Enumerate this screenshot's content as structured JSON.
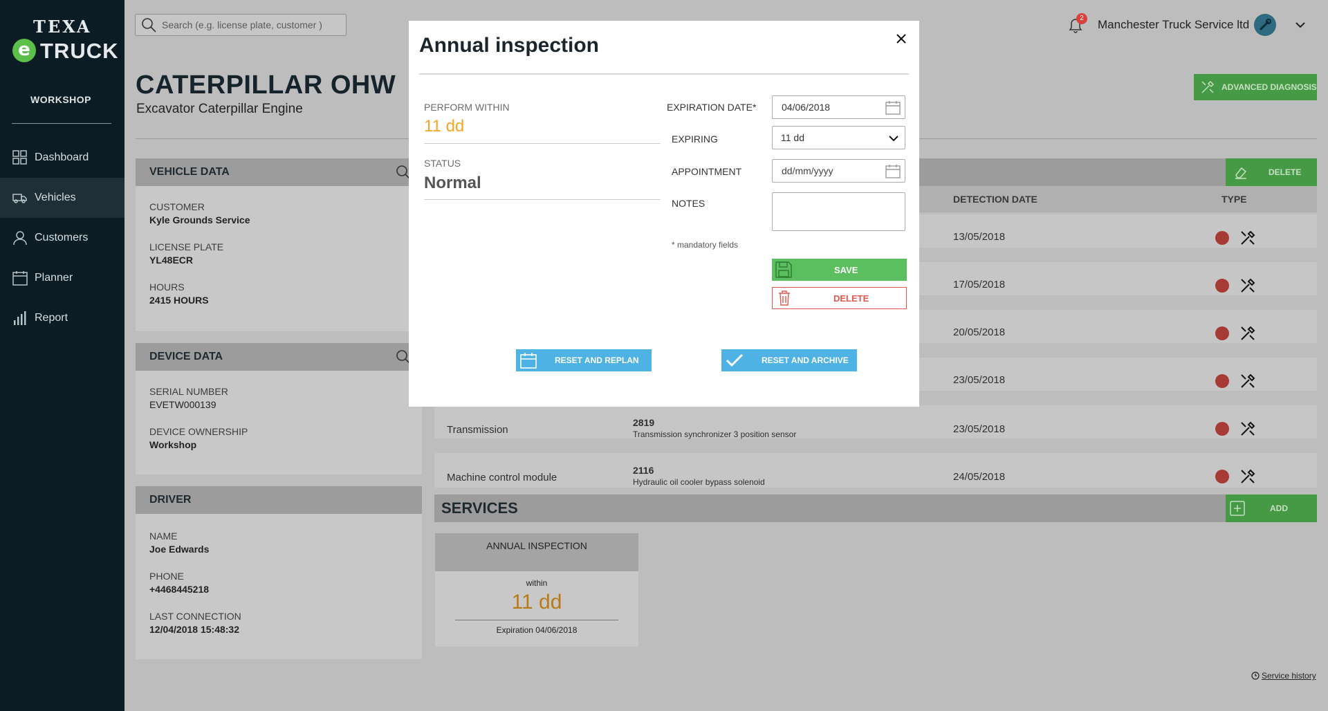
{
  "brand": {
    "line1": "TEXA",
    "e": "e",
    "line2": "TRUCK"
  },
  "sidebar": {
    "section": "WORKSHOP",
    "items": [
      {
        "label": "Dashboard",
        "icon": "grid-icon"
      },
      {
        "label": "Vehicles",
        "icon": "truck-icon",
        "active": true
      },
      {
        "label": "Customers",
        "icon": "user-icon"
      },
      {
        "label": "Planner",
        "icon": "calendar-icon"
      },
      {
        "label": "Report",
        "icon": "bar-chart-icon"
      }
    ]
  },
  "topbar": {
    "search_placeholder": "Search (e.g. license plate, customer )",
    "notifications": "2",
    "company": "Manchester Truck Service ltd"
  },
  "vehicle": {
    "title": "CATERPILLAR OHW",
    "subtitle": "Excavator Caterpillar Engine",
    "advanced_diagnosis": "ADVANCED DIAGNOSIS"
  },
  "panels": {
    "vehicle_data": {
      "title": "VEHICLE DATA",
      "fields": [
        {
          "label": "CUSTOMER",
          "value": "Kyle Grounds Service"
        },
        {
          "label": "LICENSE PLATE",
          "value": "YL48ECR"
        },
        {
          "label": "HOURS",
          "value": "2415 HOURS"
        }
      ]
    },
    "device_data": {
      "title": "DEVICE DATA",
      "fields": [
        {
          "label": "SERIAL NUMBER",
          "value": "EVETW000139"
        },
        {
          "label": "DEVICE OWNERSHIP",
          "value": "Workshop"
        }
      ]
    },
    "driver": {
      "title": "DRIVER",
      "fields": [
        {
          "label": "NAME",
          "value": "Joe Edwards"
        },
        {
          "label": "PHONE",
          "value": "+4468445218"
        },
        {
          "label": "LAST CONNECTION",
          "value": "12/04/2018 15:48:32"
        }
      ]
    }
  },
  "faults": {
    "delete_label": "DELETE",
    "columns": {
      "detection_date": "DETECTION DATE",
      "type": "TYPE"
    },
    "rows": [
      {
        "system": "",
        "code": "",
        "desc": "",
        "date": "13/05/2018"
      },
      {
        "system": "",
        "code": "",
        "desc": "",
        "date": "17/05/2018"
      },
      {
        "system": "",
        "code": "",
        "desc": "",
        "date": "20/05/2018"
      },
      {
        "system": "",
        "code": "",
        "desc": "",
        "date": "23/05/2018"
      },
      {
        "system": "Transmission",
        "code": "2819",
        "desc": "Transmission synchronizer 3 position sensor",
        "date": "23/05/2018"
      },
      {
        "system": "Machine control module",
        "code": "2116",
        "desc": "Hydraulic oil cooler bypass solenoid",
        "date": "24/05/2018"
      }
    ]
  },
  "services": {
    "title": "SERVICES",
    "add_label": "ADD",
    "card": {
      "name": "ANNUAL INSPECTION",
      "within": "within",
      "value": "11 dd",
      "expiration": "Expiration 04/06/2018"
    },
    "history": "Service history"
  },
  "modal": {
    "title": "Annual inspection",
    "perform_within_label": "PERFORM WITHIN",
    "perform_within_value": "11 dd",
    "status_label": "STATUS",
    "status_value": "Normal",
    "expiration_label": "EXPIRATION DATE*",
    "expiration_value": "04/06/2018",
    "expiring_label": "EXPIRING",
    "expiring_value": "11 dd",
    "appointment_label": "APPOINTMENT",
    "appointment_placeholder": "dd/mm/yyyy",
    "notes_label": "NOTES",
    "mandatory": "* mandatory fields",
    "save": "SAVE",
    "delete": "DELETE",
    "reset_replan": "RESET AND REPLAN",
    "reset_archive": "RESET AND ARCHIVE"
  },
  "colors": {
    "sidebar_bg": "#0b1c24",
    "accent_green": "#5bbf5f",
    "accent_blue": "#4eb3e4",
    "warning_orange": "#f5a623",
    "danger_red": "#e0574c"
  }
}
